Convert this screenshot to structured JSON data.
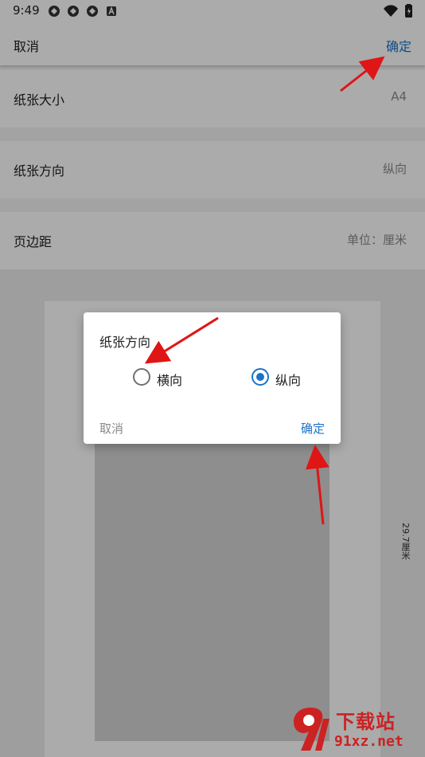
{
  "status_bar": {
    "time": "9:49",
    "icons": [
      "app-notification-icon",
      "app-notification-icon",
      "app-notification-icon",
      "text-notification-icon",
      "wifi-icon",
      "battery-icon"
    ]
  },
  "top_bar": {
    "cancel_label": "取消",
    "confirm_label": "确定"
  },
  "settings": {
    "paper_size": {
      "label": "纸张大小",
      "value": "A4"
    },
    "paper_orientation": {
      "label": "纸张方向",
      "value": "纵向"
    },
    "page_margin": {
      "label": "页边距",
      "value": "单位：厘米"
    }
  },
  "preview": {
    "height_label": "29.7厘米"
  },
  "dialog": {
    "title": "纸张方向",
    "options": [
      {
        "label": "横向",
        "selected": false
      },
      {
        "label": "纵向",
        "selected": true
      }
    ],
    "cancel_label": "取消",
    "confirm_label": "确定"
  },
  "watermark": {
    "brand": "下载站",
    "url": "91xz.net"
  },
  "colors": {
    "accent": "#1a73c8",
    "arrow": "#e01515",
    "watermark": "#cc2222"
  }
}
